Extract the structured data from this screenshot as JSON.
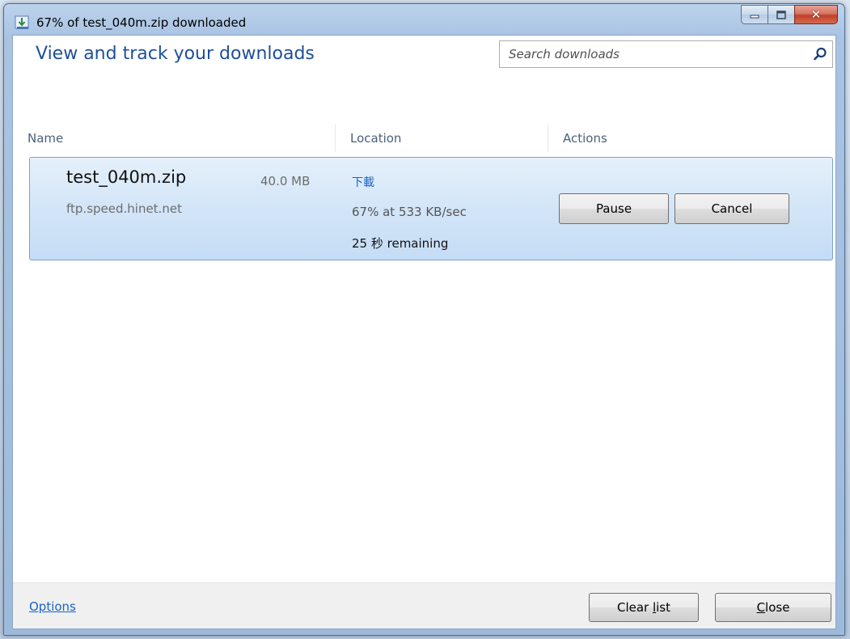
{
  "window": {
    "title": "67% of test_040m.zip downloaded"
  },
  "header": {
    "title": "View and track your downloads",
    "search_placeholder": "Search downloads"
  },
  "columns": {
    "name": "Name",
    "location": "Location",
    "actions": "Actions"
  },
  "download": {
    "file_name": "test_040m.zip",
    "size": "40.0 MB",
    "source": "ftp.speed.hinet.net",
    "location": "下載",
    "progress_text": "67% at 533 KB/sec",
    "remaining": "25 秒 remaining",
    "progress_percent": 67,
    "pause_label": "Pause",
    "cancel_label": "Cancel"
  },
  "footer": {
    "options_label": "Options",
    "clear_label_pre": "Clear ",
    "clear_label_u": "l",
    "clear_label_post": "ist",
    "close_label_u": "C",
    "close_label_post": "lose"
  },
  "colors": {
    "title_blue": "#1e4f9a",
    "link_blue": "#1a63c7",
    "row_highlight": "#d3e5f8"
  }
}
